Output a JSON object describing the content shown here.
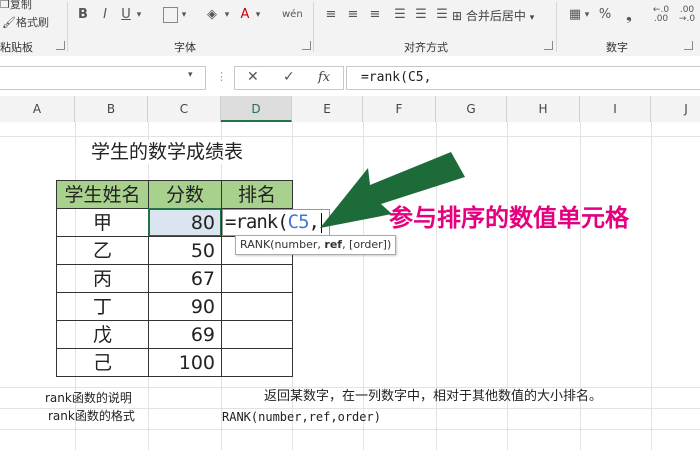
{
  "ribbon": {
    "clipboard": {
      "copy_label": "复制",
      "format_painter_label": "格式刷",
      "group_label": "粘贴板"
    },
    "font": {
      "bold": "B",
      "italic": "I",
      "underline": "U",
      "group_label": "字体"
    },
    "alignment": {
      "merge_center_label": "合并后居中",
      "group_label": "对齐方式"
    },
    "number": {
      "percent": "%",
      "group_label": "数字"
    }
  },
  "formula_bar": {
    "cancel_symbol": "✕",
    "enter_symbol": "✓",
    "fx_label": "fx",
    "content": "=rank(C5,"
  },
  "columns": [
    "A",
    "B",
    "C",
    "D",
    "E",
    "F",
    "G",
    "H",
    "I",
    "J"
  ],
  "sheet": {
    "title": "学生的数学成绩表",
    "headers": [
      "学生姓名",
      "分数",
      "排名"
    ],
    "rows": [
      {
        "name": "甲",
        "score": "80"
      },
      {
        "name": "乙",
        "score": "50"
      },
      {
        "name": "丙",
        "score": "67"
      },
      {
        "name": "丁",
        "score": "90"
      },
      {
        "name": "戊",
        "score": "69"
      },
      {
        "name": "己",
        "score": "100"
      }
    ],
    "edit_prefix": "=rank(",
    "edit_ref": "C5",
    "edit_suffix": ",",
    "tooltip": {
      "func": "RANK(number, ",
      "bold": "ref",
      "rest": ", [order])"
    },
    "annotation": "参与排序的数值单元格",
    "notes": [
      {
        "label": "rank函数的说明",
        "text": "返回某数字，在一列数字中，相对于其他数值的大小排名。"
      },
      {
        "label": "rank函数的格式",
        "text": "RANK(number,ref,order)"
      }
    ]
  },
  "colors": {
    "header_fill": "#a9d18e",
    "arrow": "#1e6b3a",
    "annotation": "#e4007f",
    "selection": "#217346",
    "ref_text": "#3c78d8"
  }
}
